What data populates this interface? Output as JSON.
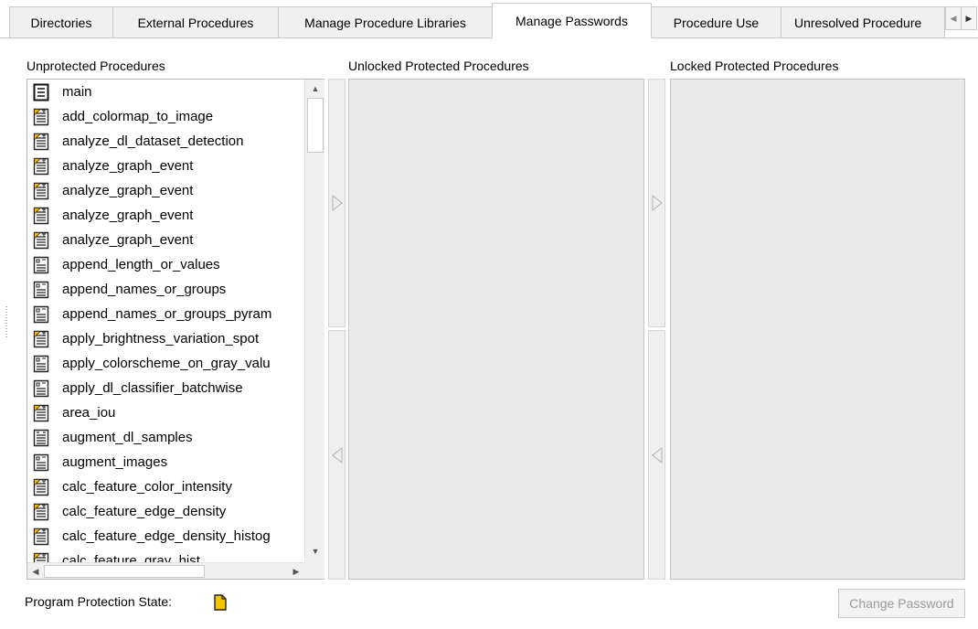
{
  "tabs": [
    {
      "label": "Directories",
      "active": false
    },
    {
      "label": "External Procedures",
      "active": false
    },
    {
      "label": "Manage Procedure Libraries",
      "active": false
    },
    {
      "label": "Manage Passwords",
      "active": true
    },
    {
      "label": "Procedure Use",
      "active": false
    },
    {
      "label": "Unresolved Procedure",
      "active": false
    }
  ],
  "panels": {
    "unprotected_title": "Unprotected Procedures",
    "unlocked_title": "Unlocked Protected Procedures",
    "locked_title": "Locked Protected Procedures"
  },
  "procedures": [
    {
      "name": "main",
      "icon": "program-icon"
    },
    {
      "name": "add_colormap_to_image",
      "icon": "local-procedure-icon"
    },
    {
      "name": "analyze_dl_dataset_detection",
      "icon": "local-procedure-icon"
    },
    {
      "name": "analyze_graph_event",
      "icon": "local-procedure-icon"
    },
    {
      "name": "analyze_graph_event",
      "icon": "local-procedure-icon"
    },
    {
      "name": "analyze_graph_event",
      "icon": "local-procedure-icon"
    },
    {
      "name": "analyze_graph_event",
      "icon": "local-procedure-icon"
    },
    {
      "name": "append_length_or_values",
      "icon": "external-procedure-icon"
    },
    {
      "name": "append_names_or_groups",
      "icon": "external-procedure-icon"
    },
    {
      "name": "append_names_or_groups_pyram",
      "icon": "external-procedure-icon"
    },
    {
      "name": "apply_brightness_variation_spot",
      "icon": "local-procedure-icon"
    },
    {
      "name": "apply_colorscheme_on_gray_valu",
      "icon": "external-procedure-icon"
    },
    {
      "name": "apply_dl_classifier_batchwise",
      "icon": "external-procedure-icon"
    },
    {
      "name": "area_iou",
      "icon": "local-procedure-icon"
    },
    {
      "name": "augment_dl_samples",
      "icon": "library-procedure-icon"
    },
    {
      "name": "augment_images",
      "icon": "external-procedure-icon"
    },
    {
      "name": "calc_feature_color_intensity",
      "icon": "local-procedure-icon"
    },
    {
      "name": "calc_feature_edge_density",
      "icon": "local-procedure-icon"
    },
    {
      "name": "calc_feature_edge_density_histog",
      "icon": "local-procedure-icon"
    },
    {
      "name": "calc_feature_gray_hist",
      "icon": "local-procedure-icon"
    }
  ],
  "footer": {
    "protection_state_label": "Program Protection State:",
    "protection_state_icon": "document-icon",
    "change_password_label": "Change Password"
  },
  "colors": {
    "empty_list_bg": "#eaeaea",
    "state_icon_fill": "#f5c400"
  }
}
